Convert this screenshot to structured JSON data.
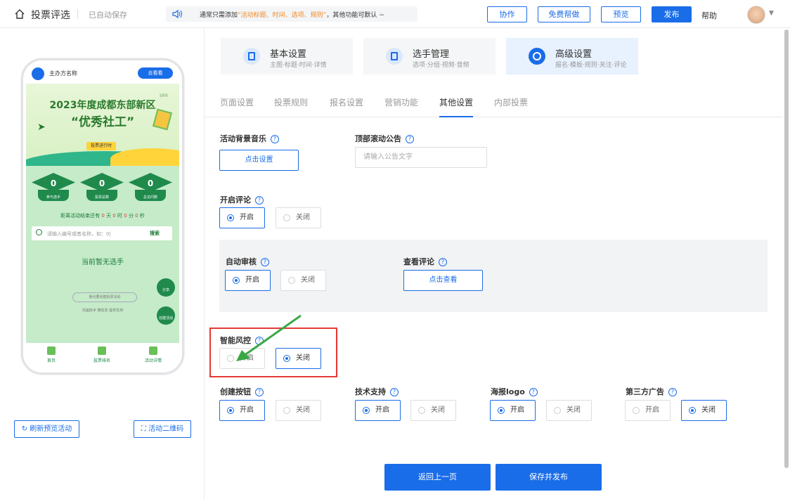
{
  "header": {
    "title": "投票评选",
    "autosave": "已自动保存",
    "notice_pre": "通常只需添加",
    "notice_highlight": "“活动标题、时间、选项、规则”",
    "notice_post": "，其他功能可默认 ~",
    "buttons": {
      "collab": "协作",
      "free_help": "免费帮做",
      "preview": "预览",
      "publish": "发布"
    },
    "help": "帮助"
  },
  "phone": {
    "org_name": "主办方名称",
    "go_vote": "去看看",
    "banner_line1": "2023年度成都东部新区",
    "banner_line2": "“优秀社工”",
    "banner_tag": "投票进行时",
    "banner_corner": "SRR",
    "stats": [
      {
        "value": "0",
        "label": "参与选手"
      },
      {
        "value": "0",
        "label": "投票总数"
      },
      {
        "value": "0",
        "label": "总访问数"
      }
    ],
    "countdown": {
      "prefix": "距离活动结束还有",
      "d": "0",
      "d_unit": "天",
      "h": "0",
      "h_unit": "时",
      "m": "0",
      "m_unit": "分",
      "s": "0",
      "s_unit": "秒"
    },
    "search_placeholder": "请输入编号或者名称，如：0|",
    "search_button": "搜索",
    "no_players": "当前暂无选手",
    "share": "分享",
    "create": "创建活动",
    "my_vote": "我也要创建投票活动",
    "powered": "页面技术 微信息 提供支持",
    "nav": [
      "首页",
      "投票排名",
      "活动详情"
    ]
  },
  "left_buttons": {
    "refresh": "刷新预览活动",
    "qrcode": "活动二维码"
  },
  "big_tabs": [
    {
      "title": "基本设置",
      "sub": "主图·标题·时间·详情"
    },
    {
      "title": "选手管理",
      "sub": "选项·分组·视频·音频"
    },
    {
      "title": "高级设置",
      "sub": "报名·模板·规则·关注·评论"
    }
  ],
  "sub_tabs": [
    "页面设置",
    "投票规则",
    "报名设置",
    "营销功能",
    "其他设置",
    "内部投票"
  ],
  "fields": {
    "bg_music": {
      "label": "活动背景音乐",
      "button": "点击设置"
    },
    "announcement": {
      "label": "顶部滚动公告",
      "placeholder": "请输入公告文字"
    },
    "comments": {
      "label": "开启评论",
      "on": "开启",
      "off": "关闭"
    },
    "auto_review": {
      "label": "自动审核",
      "on": "开启",
      "off": "关闭"
    },
    "view_comments": {
      "label": "查看评论",
      "button": "点击查看"
    },
    "risk_control": {
      "label": "智能风控",
      "on": "开启",
      "off": "关闭"
    },
    "create_button": {
      "label": "创建按钮",
      "on": "开启",
      "off": "关闭"
    },
    "tech_support": {
      "label": "技术支持",
      "on": "开启",
      "off": "关闭"
    },
    "poster_logo": {
      "label": "海报logo",
      "on": "开启",
      "off": "关闭"
    },
    "third_party_ads": {
      "label": "第三方广告",
      "on": "开启",
      "off": "关闭"
    }
  },
  "footer": {
    "back": "返回上一页",
    "save_publish": "保存并发布"
  },
  "colors": {
    "primary": "#1a6de8",
    "highlight_box": "#e53935",
    "arrow": "#3aa845"
  }
}
